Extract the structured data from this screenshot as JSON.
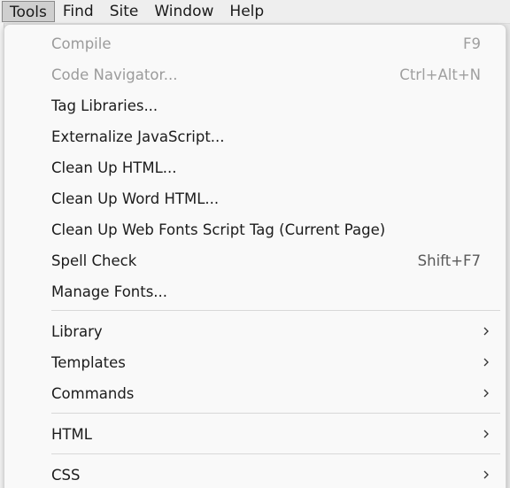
{
  "menubar": {
    "items": [
      "Tools",
      "Find",
      "Site",
      "Window",
      "Help"
    ]
  },
  "dropdown": {
    "items": [
      {
        "label": "Compile",
        "shortcut": "F9"
      },
      {
        "label": "Code Navigator...",
        "shortcut": "Ctrl+Alt+N"
      },
      {
        "label": "Tag Libraries..."
      },
      {
        "label": "Externalize JavaScript..."
      },
      {
        "label": "Clean Up HTML..."
      },
      {
        "label": "Clean Up Word HTML..."
      },
      {
        "label": "Clean Up Web Fonts Script Tag (Current Page)"
      },
      {
        "label": "Spell Check",
        "shortcut": "Shift+F7"
      },
      {
        "label": "Manage Fonts..."
      },
      {
        "label": "Library"
      },
      {
        "label": "Templates"
      },
      {
        "label": "Commands"
      },
      {
        "label": "HTML"
      },
      {
        "label": "CSS"
      }
    ]
  }
}
